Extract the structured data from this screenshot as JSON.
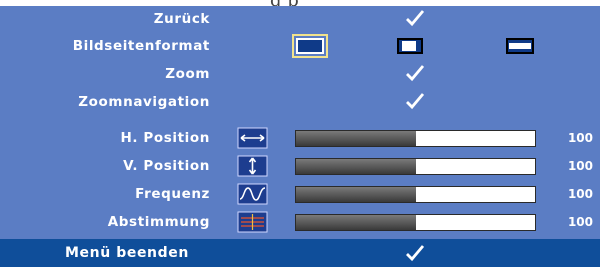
{
  "menu": {
    "items": [
      {
        "label": "Zurück",
        "type": "check"
      },
      {
        "label": "Bildseitenformat",
        "type": "aspect",
        "aspect_options": [
          "aspect-4-3-icon",
          "aspect-original-icon",
          "aspect-wide-icon"
        ],
        "selected": 0
      },
      {
        "label": "Zoom",
        "type": "check"
      },
      {
        "label": "Zoomnavigation",
        "type": "check"
      },
      {
        "label": "H. Position",
        "type": "slider",
        "icon": "h-position-icon",
        "value": "100",
        "fill": 0.5
      },
      {
        "label": "V. Position",
        "type": "slider",
        "icon": "v-position-icon",
        "value": "100",
        "fill": 0.5
      },
      {
        "label": "Frequenz",
        "type": "slider",
        "icon": "frequency-icon",
        "value": "100",
        "fill": 0.5
      },
      {
        "label": "Abstimmung",
        "type": "slider",
        "icon": "tracking-icon",
        "value": "100",
        "fill": 0.5
      }
    ]
  },
  "footer": {
    "label": "Menü beenden"
  },
  "colors": {
    "panel": "#5b7dc4",
    "footer": "#0f4e9a",
    "selection_border": "#f2e38c"
  }
}
